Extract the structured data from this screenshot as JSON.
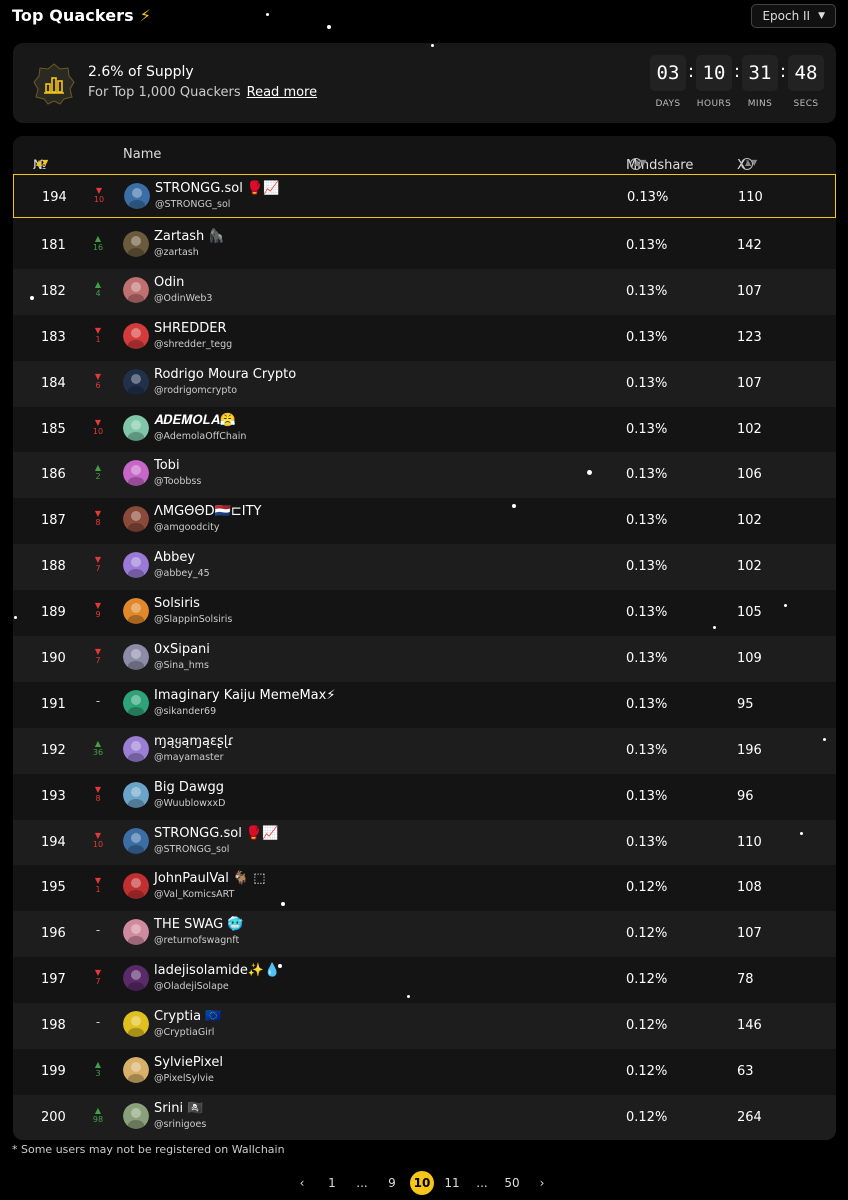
{
  "header": {
    "title": "Top Quackers",
    "epoch": "Epoch II"
  },
  "banner": {
    "supply_title": "2.6% of Supply",
    "supply_sub": "For Top 1,000 Quackers",
    "read_more": "Read more",
    "timer": [
      {
        "value": "03",
        "label": "DAYS"
      },
      {
        "value": "10",
        "label": "HOURS"
      },
      {
        "value": "31",
        "label": "MINS"
      },
      {
        "value": "48",
        "label": "SECS"
      }
    ]
  },
  "table": {
    "columns": {
      "rank": "№",
      "name": "Name",
      "mindshare": "Mindshare",
      "xscore": "X Score"
    },
    "pinned": {
      "rank": "194",
      "change": "10",
      "dir": "down",
      "name": "STRONGG.sol 🥊📈",
      "handle": "@STRONGG_sol",
      "mindshare": "0.13%",
      "xscore": "110",
      "avatar_color": "#3a6ea5"
    },
    "rows": [
      {
        "rank": "181",
        "change": "16",
        "dir": "up",
        "name": "Zartash 🦍",
        "handle": "@zartash",
        "mindshare": "0.13%",
        "xscore": "142",
        "avatar_color": "#6b5a3e"
      },
      {
        "rank": "182",
        "change": "4",
        "dir": "up",
        "name": "Odin",
        "handle": "@OdinWeb3",
        "mindshare": "0.13%",
        "xscore": "107",
        "avatar_color": "#c07070"
      },
      {
        "rank": "183",
        "change": "1",
        "dir": "down",
        "name": "SHREDDER",
        "handle": "@shredder_tegg",
        "mindshare": "0.13%",
        "xscore": "123",
        "avatar_color": "#d33a3a"
      },
      {
        "rank": "184",
        "change": "6",
        "dir": "down",
        "name": "Rodrigo Moura Crypto",
        "handle": "@rodrigomcrypto",
        "mindshare": "0.13%",
        "xscore": "107",
        "avatar_color": "#20304a"
      },
      {
        "rank": "185",
        "change": "10",
        "dir": "down",
        "name": "𝑨𝑫𝑬𝑴𝑶𝑳𝑨😤",
        "handle": "@AdemolaOffChain",
        "mindshare": "0.13%",
        "xscore": "102",
        "avatar_color": "#7fc7a8"
      },
      {
        "rank": "186",
        "change": "2",
        "dir": "up",
        "name": "Tobi",
        "handle": "@Toobbss",
        "mindshare": "0.13%",
        "xscore": "106",
        "avatar_color": "#c766c7"
      },
      {
        "rank": "187",
        "change": "8",
        "dir": "down",
        "name": "ΛMGΘΘD🇳🇱⊏ITY",
        "handle": "@amgoodcity",
        "mindshare": "0.13%",
        "xscore": "102",
        "avatar_color": "#8a4a3a"
      },
      {
        "rank": "188",
        "change": "7",
        "dir": "down",
        "name": "Abbey",
        "handle": "@abbey_45",
        "mindshare": "0.13%",
        "xscore": "102",
        "avatar_color": "#9a7ad6"
      },
      {
        "rank": "189",
        "change": "9",
        "dir": "down",
        "name": "Solsiris",
        "handle": "@SlappinSolsiris",
        "mindshare": "0.13%",
        "xscore": "105",
        "avatar_color": "#e0882a"
      },
      {
        "rank": "190",
        "change": "7",
        "dir": "down",
        "name": "0xSipani",
        "handle": "@Sina_hms",
        "mindshare": "0.13%",
        "xscore": "109",
        "avatar_color": "#8c8ca8"
      },
      {
        "rank": "191",
        "change": "-",
        "dir": "none",
        "name": "Imaginary Kaiju MemeMax⚡",
        "handle": "@sikander69",
        "mindshare": "0.13%",
        "xscore": "95",
        "avatar_color": "#2ea37a"
      },
      {
        "rank": "192",
        "change": "36",
        "dir": "up",
        "name": "ɱąყąɱąεʂɭɾ",
        "handle": "@mayamaster",
        "mindshare": "0.13%",
        "xscore": "196",
        "avatar_color": "#9b7fd4"
      },
      {
        "rank": "193",
        "change": "8",
        "dir": "down",
        "name": "Big Dawgg",
        "handle": "@WuublowxxD",
        "mindshare": "0.13%",
        "xscore": "96",
        "avatar_color": "#6aa5c9"
      },
      {
        "rank": "194",
        "change": "10",
        "dir": "down",
        "name": "STRONGG.sol 🥊📈",
        "handle": "@STRONGG_sol",
        "mindshare": "0.13%",
        "xscore": "110",
        "avatar_color": "#3a6ea5"
      },
      {
        "rank": "195",
        "change": "1",
        "dir": "down",
        "name": "JohnPaulVal 🐐 ⬚",
        "handle": "@Val_KomicsART",
        "mindshare": "0.12%",
        "xscore": "108",
        "avatar_color": "#c03030"
      },
      {
        "rank": "196",
        "change": "-",
        "dir": "none",
        "name": "THE SWAG 🥶",
        "handle": "@returnofswagnft",
        "mindshare": "0.12%",
        "xscore": "107",
        "avatar_color": "#d08aa0"
      },
      {
        "rank": "197",
        "change": "7",
        "dir": "down",
        "name": "ladejisolamide✨💧",
        "handle": "@OladejiSolape",
        "mindshare": "0.12%",
        "xscore": "78",
        "avatar_color": "#5a2a6a"
      },
      {
        "rank": "198",
        "change": "-",
        "dir": "none",
        "name": "Cryptia 🇪🇺",
        "handle": "@CryptiaGirl",
        "mindshare": "0.12%",
        "xscore": "146",
        "avatar_color": "#e0c020"
      },
      {
        "rank": "199",
        "change": "3",
        "dir": "up",
        "name": "SylviePixel",
        "handle": "@PixelSylvie",
        "mindshare": "0.12%",
        "xscore": "63",
        "avatar_color": "#d9b06a"
      },
      {
        "rank": "200",
        "change": "98",
        "dir": "up",
        "name": "Srini 🏴‍☠️",
        "handle": "@srinigoes",
        "mindshare": "0.12%",
        "xscore": "264",
        "avatar_color": "#8aa07a"
      }
    ]
  },
  "footnote": "* Some users may not be registered on Wallchain",
  "pagination": [
    "1",
    "...",
    "9",
    "10",
    "11",
    "...",
    "50"
  ],
  "pagination_current": "10",
  "colors": {
    "accent": "#f5c518",
    "down": "#e53935",
    "up": "#43a047"
  }
}
